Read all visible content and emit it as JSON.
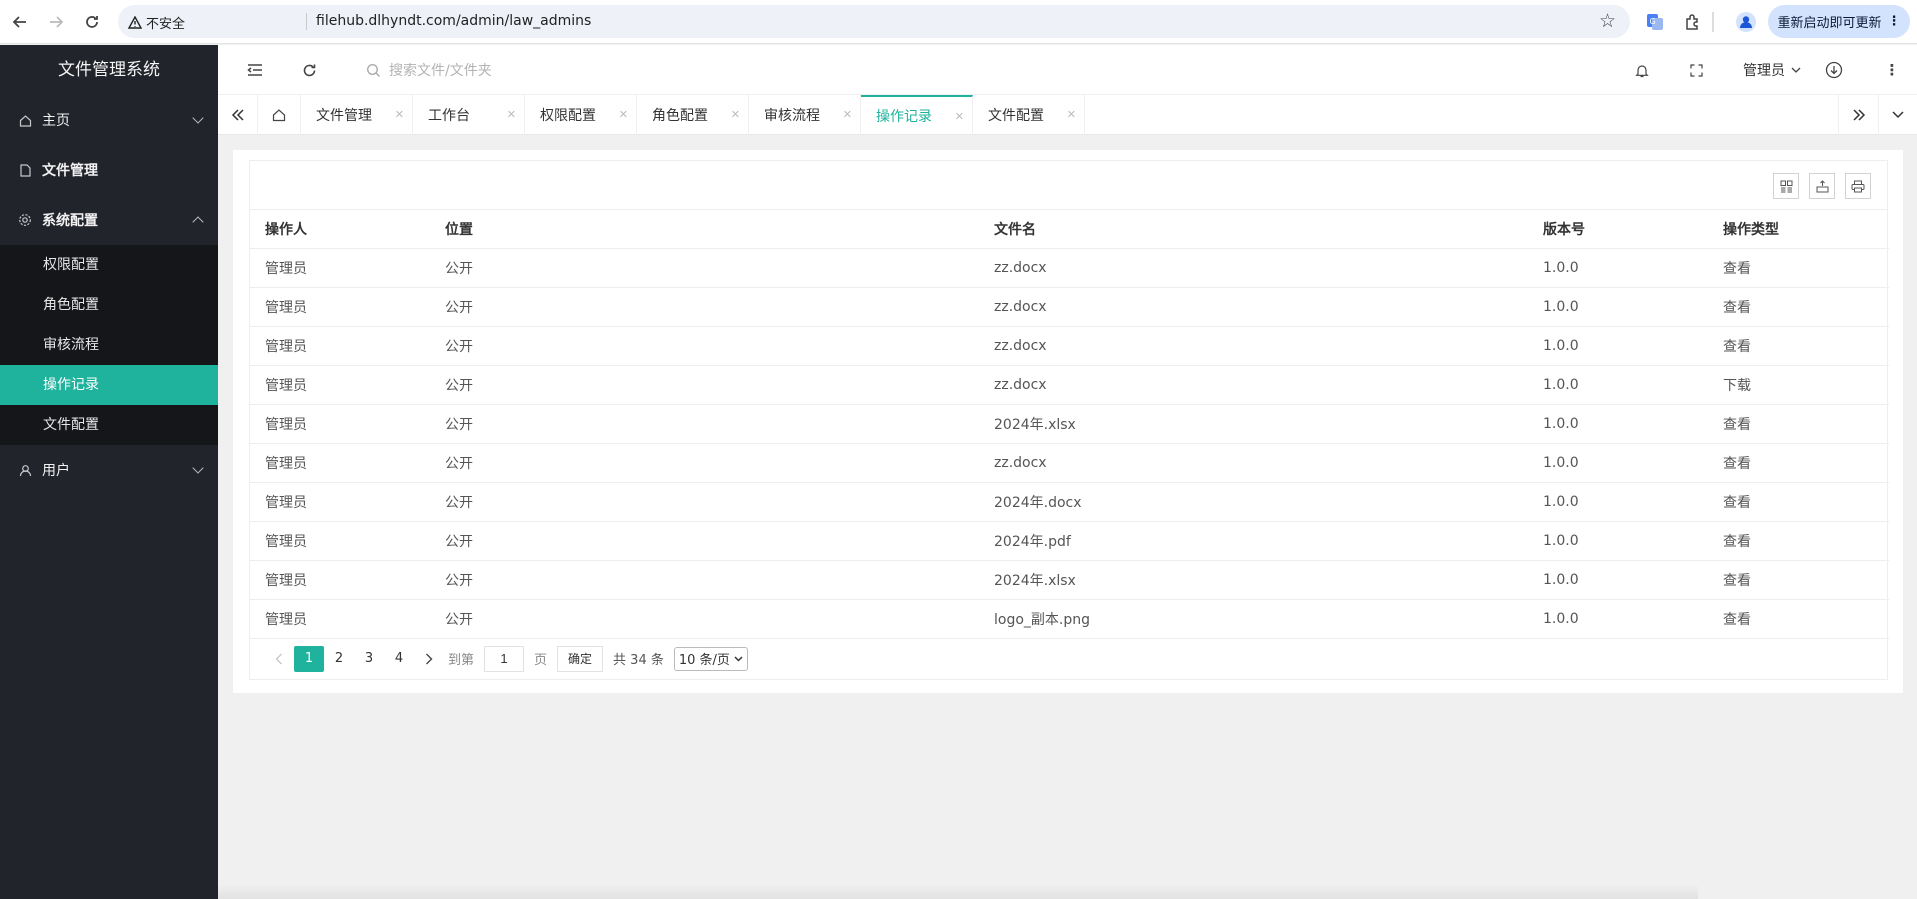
{
  "browser": {
    "insecure_label": "不安全",
    "url": "filehub.dlhyndt.com/admin/law_admins",
    "restart_label": "重新启动即可更新"
  },
  "sidebar": {
    "title": "文件管理系统",
    "items": [
      {
        "label": "主页",
        "icon": "home-icon"
      },
      {
        "label": "文件管理",
        "icon": "file-icon"
      },
      {
        "label": "系统配置",
        "icon": "gear-icon"
      },
      {
        "label": "用户",
        "icon": "user-icon"
      }
    ],
    "subitems": [
      "权限配置",
      "角色配置",
      "审核流程",
      "操作记录",
      "文件配置"
    ]
  },
  "topbar": {
    "search_placeholder": "搜索文件/文件夹",
    "user": "管理员"
  },
  "tabs": [
    "文件管理",
    "工作台",
    "权限配置",
    "角色配置",
    "审核流程",
    "操作记录",
    "文件配置"
  ],
  "active_tab": "操作记录",
  "table": {
    "columns": [
      "操作人",
      "位置",
      "文件名",
      "版本号",
      "操作类型"
    ],
    "rows": [
      [
        "管理员",
        "公开",
        "zz.docx",
        "1.0.0",
        "查看"
      ],
      [
        "管理员",
        "公开",
        "zz.docx",
        "1.0.0",
        "查看"
      ],
      [
        "管理员",
        "公开",
        "zz.docx",
        "1.0.0",
        "查看"
      ],
      [
        "管理员",
        "公开",
        "zz.docx",
        "1.0.0",
        "下载"
      ],
      [
        "管理员",
        "公开",
        "2024年.xlsx",
        "1.0.0",
        "查看"
      ],
      [
        "管理员",
        "公开",
        "zz.docx",
        "1.0.0",
        "查看"
      ],
      [
        "管理员",
        "公开",
        "2024年.docx",
        "1.0.0",
        "查看"
      ],
      [
        "管理员",
        "公开",
        "2024年.pdf",
        "1.0.0",
        "查看"
      ],
      [
        "管理员",
        "公开",
        "2024年.xlsx",
        "1.0.0",
        "查看"
      ],
      [
        "管理员",
        "公开",
        "logo_副本.png",
        "1.0.0",
        "查看"
      ]
    ]
  },
  "pager": {
    "pages": [
      "1",
      "2",
      "3",
      "4"
    ],
    "goto_label": "到第",
    "goto_value": "1",
    "page_label": "页",
    "confirm_label": "确定",
    "total_label": "共 34 条",
    "page_size_label": "10 条/页"
  },
  "colors": {
    "accent": "#1fb29d",
    "sidebar_bg": "#21242b"
  }
}
